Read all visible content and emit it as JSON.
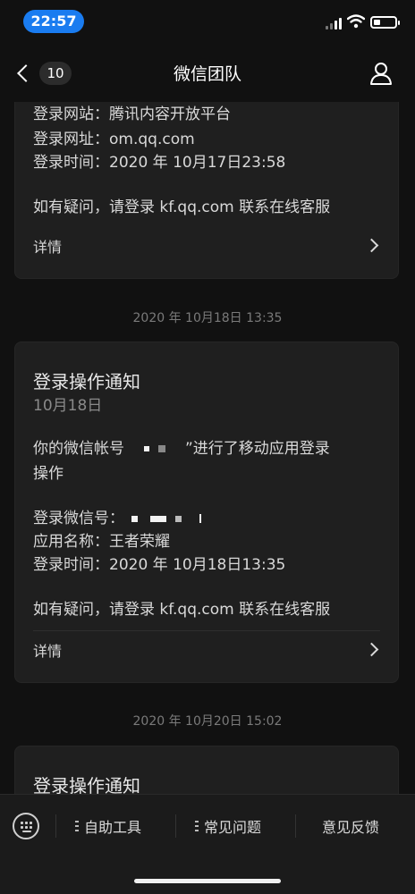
{
  "status_bar": {
    "time": "22:57",
    "battery_level": 0.3
  },
  "nav": {
    "back_count": "10",
    "title": "微信团队"
  },
  "card1": {
    "site_line": "登录网站：腾讯内容开放平台",
    "url_line": "登录网址：om.qq.com",
    "time_line": "登录时间：2020 年 10月17日23:58",
    "help_line": "如有疑问，请登录 kf.qq.com 联系在线客服",
    "details": "详情"
  },
  "timestamp2": "2020 年 10月18日 13:35",
  "card2": {
    "title": "登录操作通知",
    "date": "10月18日",
    "body_prefix": "你的微信帐号",
    "body_suffix": "”进行了移动应用登录",
    "body_line2": "操作",
    "wechat_id_label": "登录微信号：",
    "app_line": "应用名称：王者荣耀",
    "time_line": "登录时间：2020 年 10月18日13:35",
    "help_line": "如有疑问，请登录 kf.qq.com 联系在线客服",
    "details": "详情"
  },
  "timestamp3": "2020 年 10月20日 15:02",
  "card3": {
    "title": "登录操作通知"
  },
  "bottom_menu": {
    "item1": "自助工具",
    "item2": "常见问题",
    "item3": "意见反馈"
  }
}
